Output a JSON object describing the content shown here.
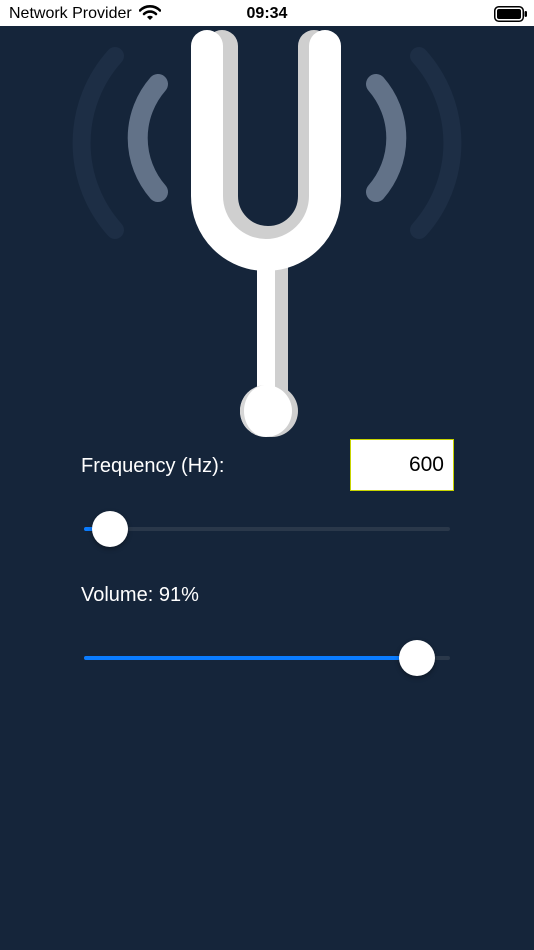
{
  "status_bar": {
    "carrier": "Network Provider",
    "time": "09:34"
  },
  "frequency": {
    "label": "Frequency (Hz):",
    "value": "600",
    "slider_fraction": 0.07
  },
  "volume": {
    "label": "Volume: 91%",
    "slider_fraction": 0.91
  },
  "icons": [
    "wifi-icon",
    "battery-icon",
    "tuning-fork-icon"
  ],
  "colors": {
    "background": "#15253a",
    "accent": "#0a7cff",
    "input_border": "#c8d400",
    "slider_track": "#2a384a"
  }
}
